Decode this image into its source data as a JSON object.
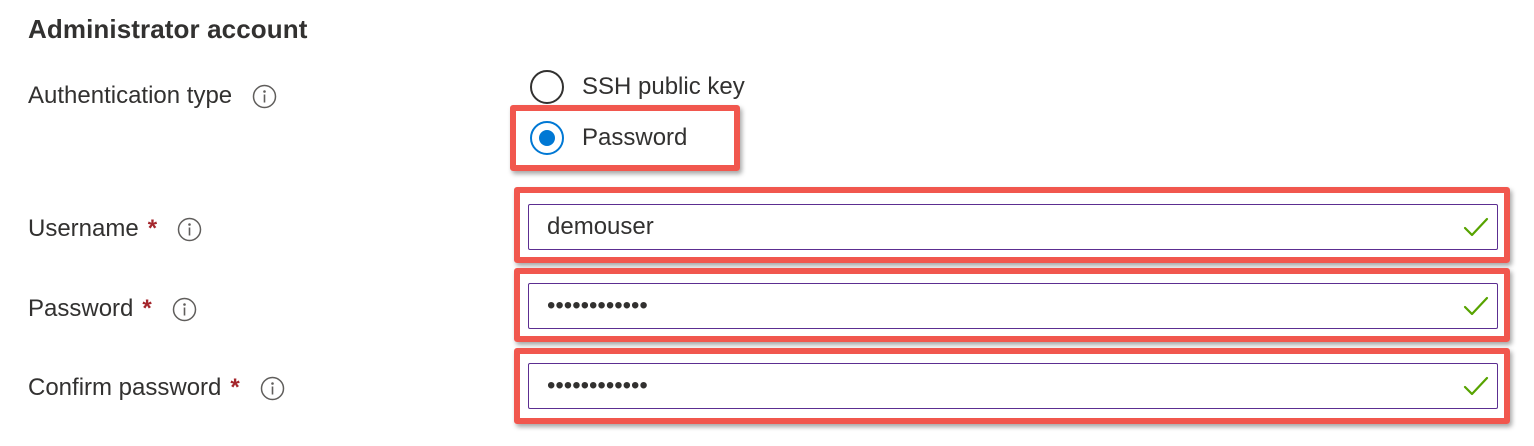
{
  "section": {
    "title": "Administrator account"
  },
  "auth_type": {
    "label": "Authentication type",
    "info_icon": "info-icon",
    "options": [
      {
        "label": "SSH public key",
        "selected": false
      },
      {
        "label": "Password",
        "selected": true
      }
    ]
  },
  "username": {
    "label": "Username",
    "required_marker": "*",
    "value": "demouser",
    "valid_icon": "checkmark-icon"
  },
  "password": {
    "label": "Password",
    "required_marker": "*",
    "value": "••••••••••••",
    "valid_icon": "checkmark-icon"
  },
  "confirm_password": {
    "label": "Confirm password",
    "required_marker": "*",
    "value": "••••••••••••",
    "valid_icon": "checkmark-icon"
  },
  "colors": {
    "highlight": "#f1574e",
    "radio_selected": "#0078d4",
    "required": "#a4262c",
    "valid_check": "#57a300",
    "input_border": "#5c2e91"
  }
}
